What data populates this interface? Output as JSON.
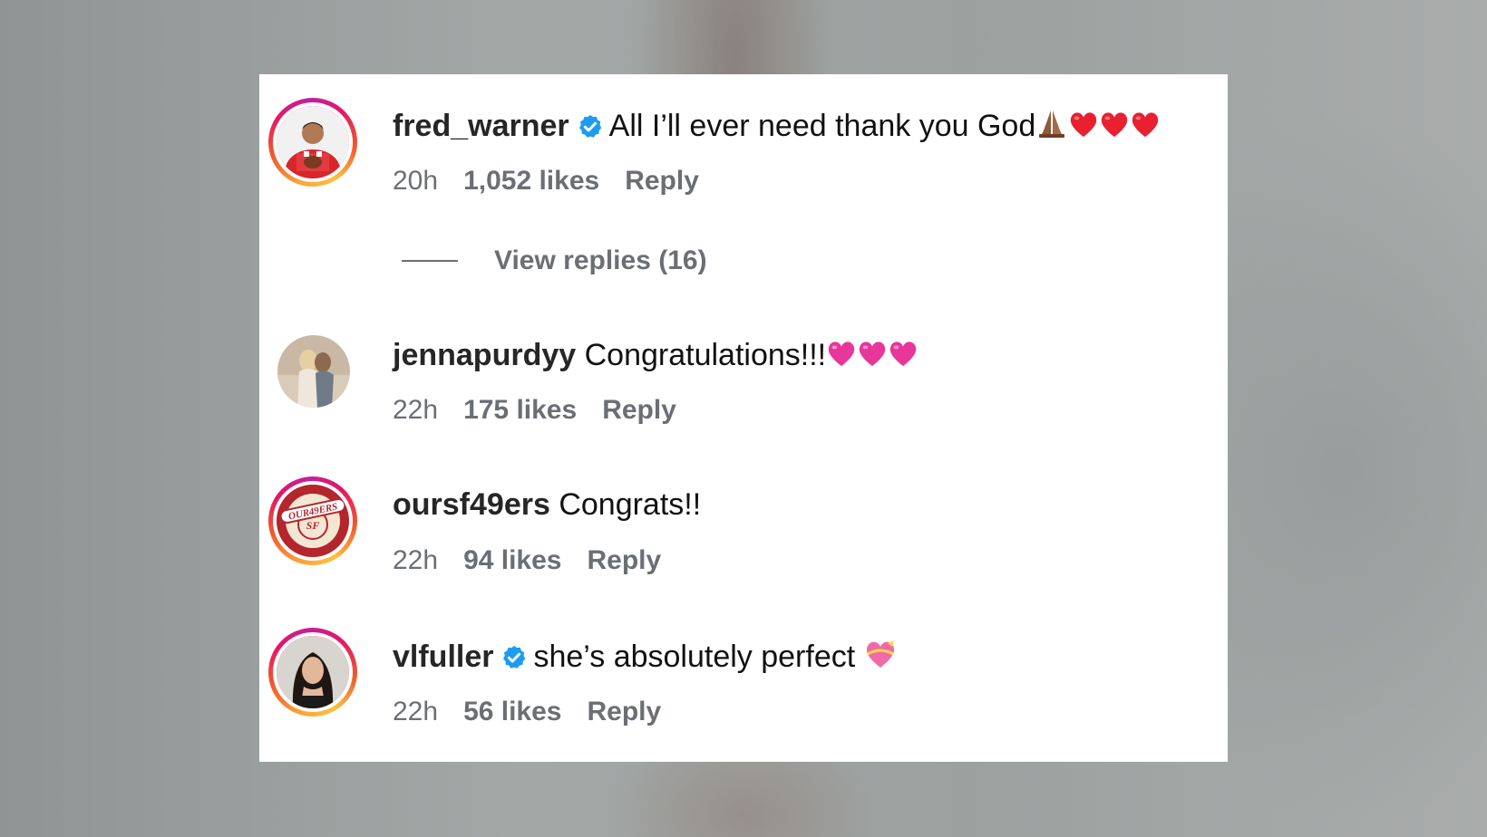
{
  "comments": [
    {
      "username": "fred_warner",
      "verified": true,
      "text": "All I’ll ever need thank you God",
      "emojis": [
        "praying-hands-emoji",
        "red-heart-emoji",
        "red-heart-emoji",
        "red-heart-emoji"
      ],
      "time": "20h",
      "likes": "1,052 likes",
      "reply": "Reply",
      "view_replies": "View replies (16)"
    },
    {
      "username": "jennapurdyy",
      "verified": false,
      "text": "Congratulations!!!",
      "emojis": [
        "pink-heart-emoji",
        "pink-heart-emoji",
        "pink-heart-emoji"
      ],
      "time": "22h",
      "likes": "175 likes",
      "reply": "Reply"
    },
    {
      "username": "oursf49ers",
      "verified": false,
      "text": "Congrats!!",
      "avatar_logo_text": "OUR49ERS",
      "time": "22h",
      "likes": "94 likes",
      "reply": "Reply"
    },
    {
      "username": "vlfuller",
      "verified": true,
      "text": "she’s absolutely perfect",
      "emojis": [
        "heart-with-ribbon-emoji"
      ],
      "time": "22h",
      "likes": "56 likes",
      "reply": "Reply"
    }
  ],
  "colors": {
    "verified_badge": "#1d9bf0",
    "meta_text": "#6b6f75",
    "heart_red": "#e8202f",
    "heart_pink": "#e8369a"
  }
}
